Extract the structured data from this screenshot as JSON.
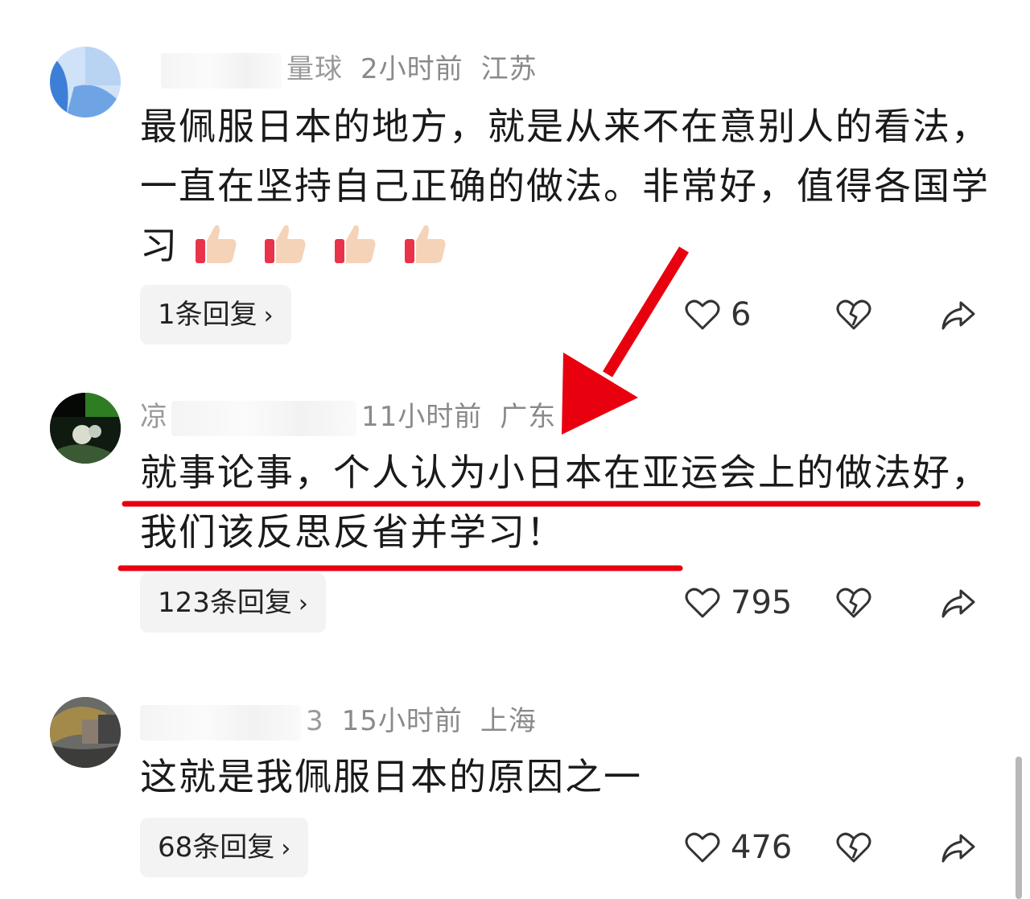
{
  "comments": [
    {
      "name_tail": "量球",
      "time": "2小时前",
      "location": "江苏",
      "text": "最佩服日本的地方，就是从来不在意别人的看法，一直在坚持自己正确的做法。非常好，值得各国学习",
      "emoji_icons": [
        "thumbs-up-icon",
        "thumbs-up-icon",
        "thumbs-up-icon",
        "thumbs-up-icon"
      ],
      "replies_label": "1条回复",
      "likes": "6"
    },
    {
      "name_tail": "凉",
      "time": "11小时前",
      "location": "广东",
      "text": "就事论事，个人认为小日本在亚运会上的做法好，我们该反思反省并学习！",
      "replies_label": "123条回复",
      "likes": "795"
    },
    {
      "name_tail": "3",
      "time": "15小时前",
      "location": "上海",
      "text": "这就是我佩服日本的原因之一",
      "replies_label": "68条回复",
      "likes": "476"
    }
  ],
  "icons": {
    "chevron": "chevron-right-icon",
    "like": "heart-icon",
    "dislike": "broken-heart-icon",
    "share": "share-arrow-icon"
  },
  "annotation_color": "#e8000f"
}
